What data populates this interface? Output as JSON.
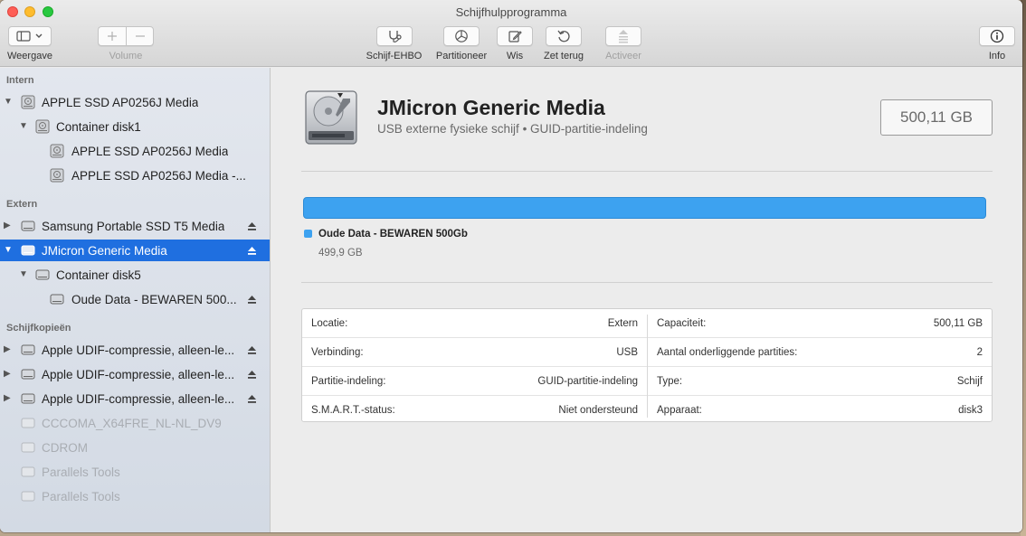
{
  "window": {
    "title": "Schijfhulpprogramma"
  },
  "toolbar": {
    "view_label": "Weergave",
    "volume_label": "Volume",
    "first_aid_label": "Schijf-EHBO",
    "partition_label": "Partitioneer",
    "erase_label": "Wis",
    "restore_label": "Zet terug",
    "mount_label": "Activeer",
    "info_label": "Info"
  },
  "sidebar": {
    "sections": [
      {
        "title": "Intern"
      },
      {
        "title": "Extern"
      },
      {
        "title": "Schijfkopieën"
      }
    ],
    "items": [
      {
        "label": "APPLE SSD AP0256J Media"
      },
      {
        "label": "Container disk1"
      },
      {
        "label": "APPLE SSD AP0256J Media"
      },
      {
        "label": "APPLE SSD AP0256J Media -..."
      },
      {
        "label": "Samsung Portable SSD T5 Media"
      },
      {
        "label": "JMicron Generic Media"
      },
      {
        "label": "Container disk5"
      },
      {
        "label": "Oude Data - BEWAREN 500..."
      },
      {
        "label": "Apple UDIF-compressie, alleen-le..."
      },
      {
        "label": "Apple UDIF-compressie, alleen-le..."
      },
      {
        "label": "Apple UDIF-compressie, alleen-le..."
      },
      {
        "label": "CCCOMA_X64FRE_NL-NL_DV9"
      },
      {
        "label": "CDROM"
      },
      {
        "label": "Parallels Tools"
      },
      {
        "label": "Parallels Tools"
      }
    ]
  },
  "main": {
    "disk_name": "JMicron Generic Media",
    "disk_subtitle": "USB externe fysieke schijf • GUID-partitie-indeling",
    "capacity": "500,11 GB",
    "partition": {
      "name": "Oude Data - BEWAREN 500Gb",
      "size": "499,9 GB",
      "color": "#3da2f0"
    },
    "info": {
      "left": [
        {
          "label": "Locatie:",
          "value": "Extern"
        },
        {
          "label": "Verbinding:",
          "value": "USB"
        },
        {
          "label": "Partitie-indeling:",
          "value": "GUID-partitie-indeling"
        },
        {
          "label": "S.M.A.R.T.-status:",
          "value": "Niet ondersteund"
        }
      ],
      "right": [
        {
          "label": "Capaciteit:",
          "value": "500,11 GB"
        },
        {
          "label": "Aantal onderliggende partities:",
          "value": "2"
        },
        {
          "label": "Type:",
          "value": "Schijf"
        },
        {
          "label": "Apparaat:",
          "value": "disk3"
        }
      ]
    }
  },
  "colors": {
    "selection": "#1f6fe0",
    "accent": "#3da2f0"
  }
}
